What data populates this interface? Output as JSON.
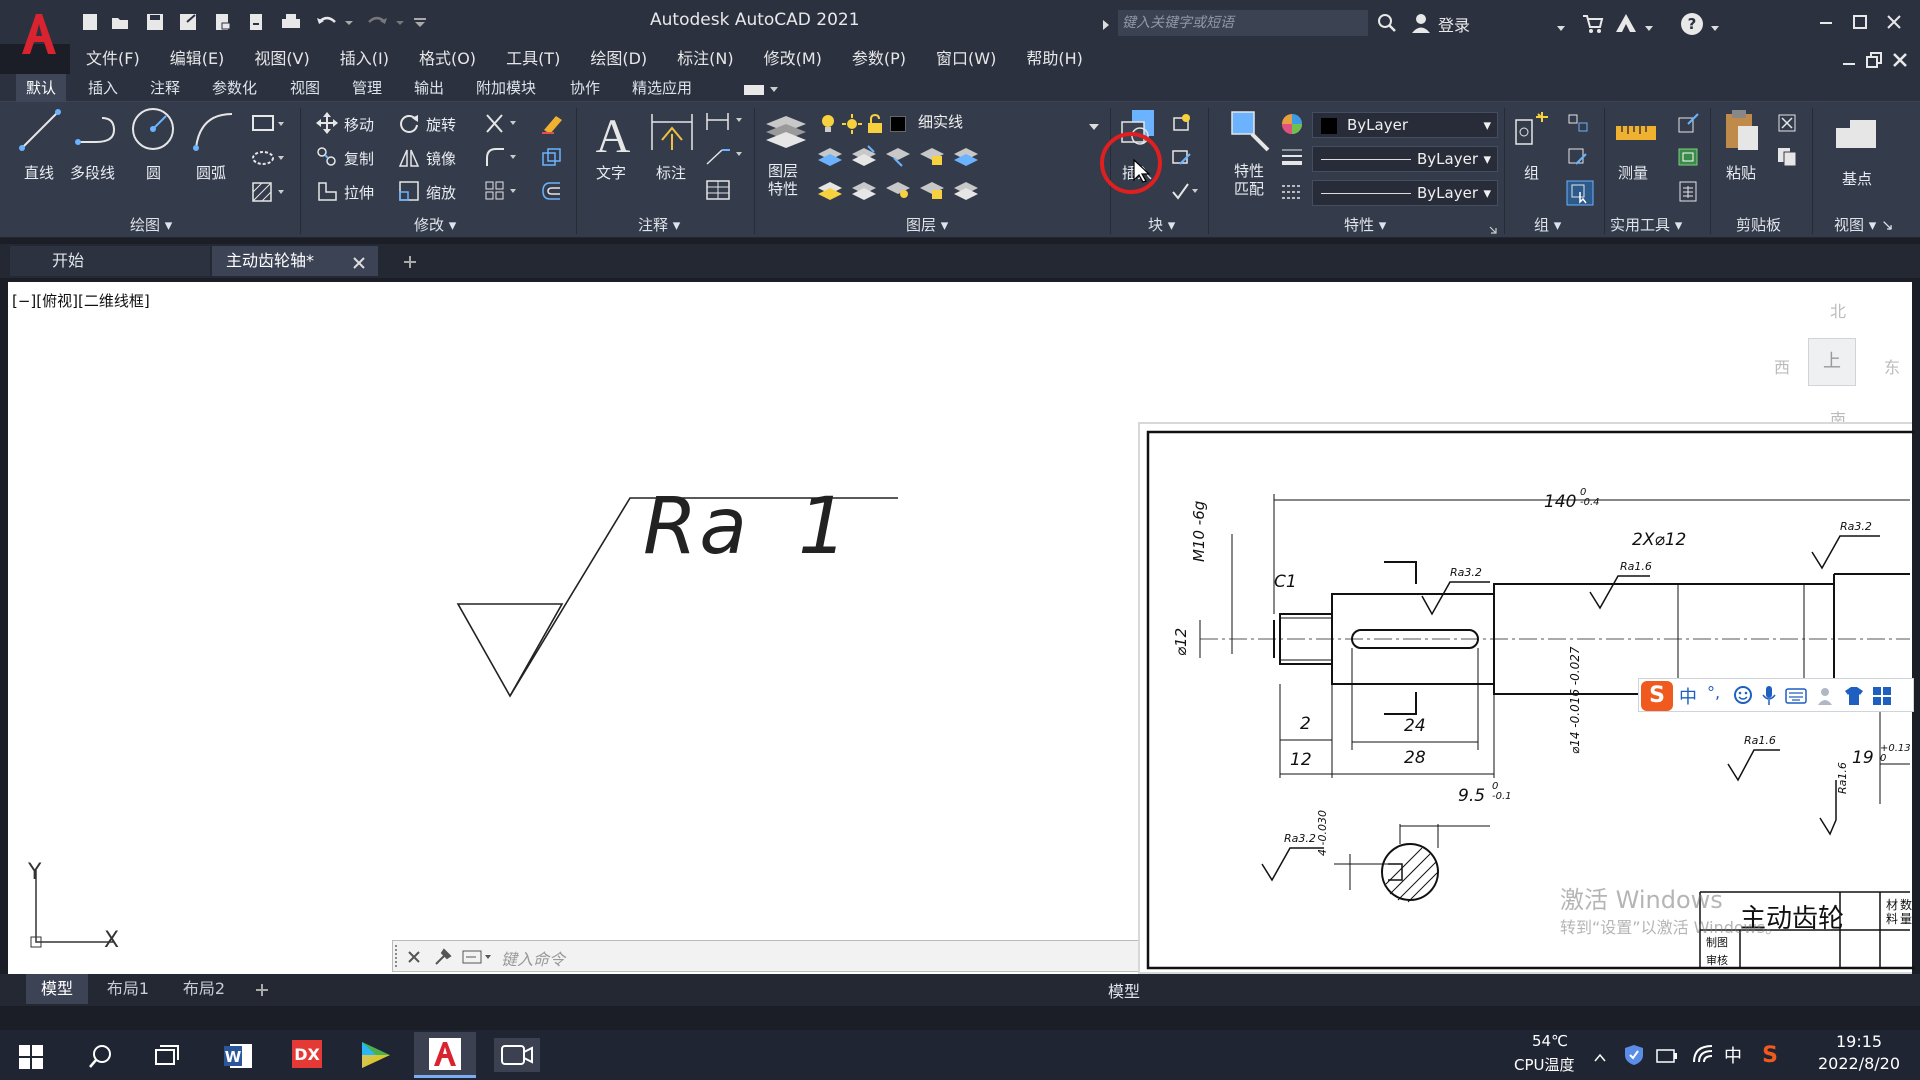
{
  "app": {
    "title": "Autodesk AutoCAD 2021",
    "logo_letter": "A",
    "search_placeholder": "键入关键字或短语",
    "login": "登录"
  },
  "menu": [
    "文件(F)",
    "编辑(E)",
    "视图(V)",
    "插入(I)",
    "格式(O)",
    "工具(T)",
    "绘图(D)",
    "标注(N)",
    "修改(M)",
    "参数(P)",
    "窗口(W)",
    "帮助(H)"
  ],
  "ribbon_tabs": [
    "默认",
    "插入",
    "注释",
    "参数化",
    "视图",
    "管理",
    "输出",
    "附加模块",
    "协作",
    "精选应用"
  ],
  "ribbon": {
    "draw": {
      "line": "直线",
      "polyline": "多段线",
      "circle": "圆",
      "arc": "圆弧",
      "panel": "绘图"
    },
    "modify": {
      "move": "移动",
      "rotate": "旋转",
      "copy": "复制",
      "mirror": "镜像",
      "stretch": "拉伸",
      "scale": "缩放",
      "panel": "修改"
    },
    "annotation": {
      "text": "文字",
      "dimension": "标注",
      "panel": "注释"
    },
    "layers": {
      "properties": "图层特性",
      "current_layer": "细实线",
      "panel": "图层"
    },
    "block": {
      "insert": "插入",
      "panel": "块"
    },
    "properties": {
      "match": "特性匹配",
      "color": "ByLayer",
      "linetype": "ByLayer",
      "lineweight": "ByLayer",
      "panel": "特性"
    },
    "groups": {
      "group": "组",
      "panel": "组"
    },
    "utilities": {
      "measure": "测量",
      "panel": "实用工具"
    },
    "clipboard": {
      "paste": "粘贴",
      "panel": "剪贴板"
    },
    "view": {
      "base": "基点",
      "panel": "视图"
    }
  },
  "doc_tabs": {
    "start": "开始",
    "active": "主动齿轮轴*"
  },
  "viewport": {
    "label": "[−][俯视][二维线框]",
    "viewcube": {
      "north": "北",
      "south": "南",
      "east": "东",
      "west": "西",
      "face": "上"
    },
    "ucs_x": "X",
    "ucs_y": "Y"
  },
  "roughness_symbol": {
    "ra": "Ra",
    "value": "1"
  },
  "command_placeholder": "键入命令",
  "layout_tabs": [
    "模型",
    "布局1",
    "布局2"
  ],
  "model_button": "模型",
  "drawing_preview": {
    "dims": {
      "total_length": "140",
      "total_tol": "0 -0.4",
      "holes": "2X⌀12",
      "thread": "M10 -6g",
      "dia12": "⌀12",
      "chamfer": "C1",
      "d2": "2",
      "d12": "12",
      "d24": "24",
      "d28": "28",
      "d95": "9.5",
      "d95_tol": "0 -0.1",
      "d19": "19",
      "d19_tol": "+0.13 0",
      "dia14": "⌀14 -0.016 -0.027",
      "key4": "4 -0.030"
    },
    "roughness": [
      "Ra3.2",
      "Ra1.6",
      "Ra3.2",
      "Ra1.6",
      "Ra3.2",
      "Ra1.6"
    ],
    "title_block": {
      "part_name": "主动齿轮",
      "drawn": "制图",
      "checked": "审核",
      "material": "材料",
      "quantity": "数量"
    }
  },
  "watermark": {
    "line1": "激活 Windows",
    "line2": "转到“设置”以激活 Windows。"
  },
  "ime_label": "中",
  "taskbar": {
    "temp": "54℃",
    "temp_label": "CPU温度",
    "ime": "中",
    "time": "19:15",
    "date": "2022/8/20"
  },
  "colors": {
    "accent_red": "#d9232e",
    "ribbon_bg": "#343b4a",
    "title_bg": "#2b313f"
  }
}
